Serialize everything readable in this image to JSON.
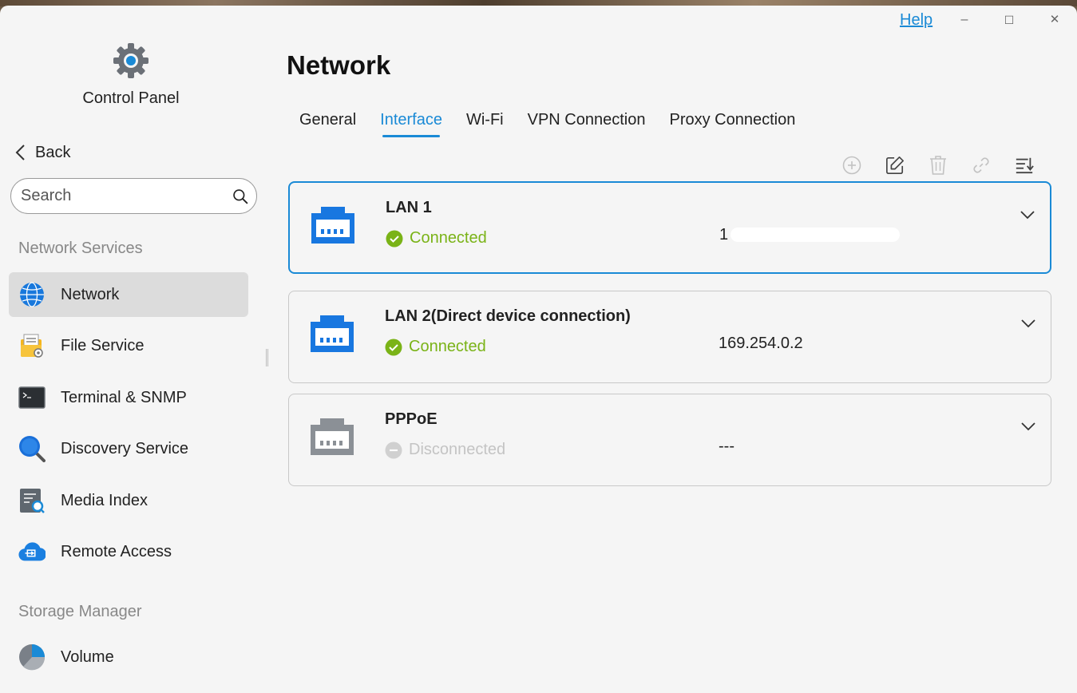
{
  "window": {
    "help_label": "Help",
    "minimize_glyph": "–",
    "maximize_glyph": "☐",
    "close_glyph": "✕"
  },
  "sidebar": {
    "app_title": "Control Panel",
    "back_label": "Back",
    "search_placeholder": "Search",
    "sections": [
      {
        "heading": "Network Services",
        "items": [
          {
            "label": "Network",
            "icon": "globe-icon",
            "active": true
          },
          {
            "label": "File Service",
            "icon": "file-service-icon"
          },
          {
            "label": "Terminal & SNMP",
            "icon": "terminal-icon"
          },
          {
            "label": "Discovery Service",
            "icon": "discovery-icon"
          },
          {
            "label": "Media Index",
            "icon": "media-index-icon"
          },
          {
            "label": "Remote Access",
            "icon": "remote-access-icon"
          }
        ]
      },
      {
        "heading": "Storage Manager",
        "items": [
          {
            "label": "Volume",
            "icon": "volume-icon"
          }
        ]
      }
    ]
  },
  "main": {
    "title": "Network",
    "tabs": [
      "General",
      "Interface",
      "Wi-Fi",
      "VPN Connection",
      "Proxy Connection"
    ],
    "active_tab": "Interface",
    "toolbar": [
      "add-icon",
      "edit-icon",
      "delete-icon",
      "link-icon",
      "sort-icon"
    ],
    "interfaces": [
      {
        "name": "LAN 1",
        "status": "Connected",
        "ip": "1",
        "connected": true,
        "selected": true
      },
      {
        "name": "LAN 2(Direct device connection)",
        "status": "Connected",
        "ip": "169.254.0.2",
        "connected": true
      },
      {
        "name": "PPPoE",
        "status": "Disconnected",
        "ip": "---",
        "connected": false
      }
    ]
  },
  "colors": {
    "accent": "#1a8ad6",
    "connected": "#7ab317",
    "disconnected": "#c4c4c4",
    "port_active": "#1877e0",
    "port_inactive": "#8b9096"
  }
}
